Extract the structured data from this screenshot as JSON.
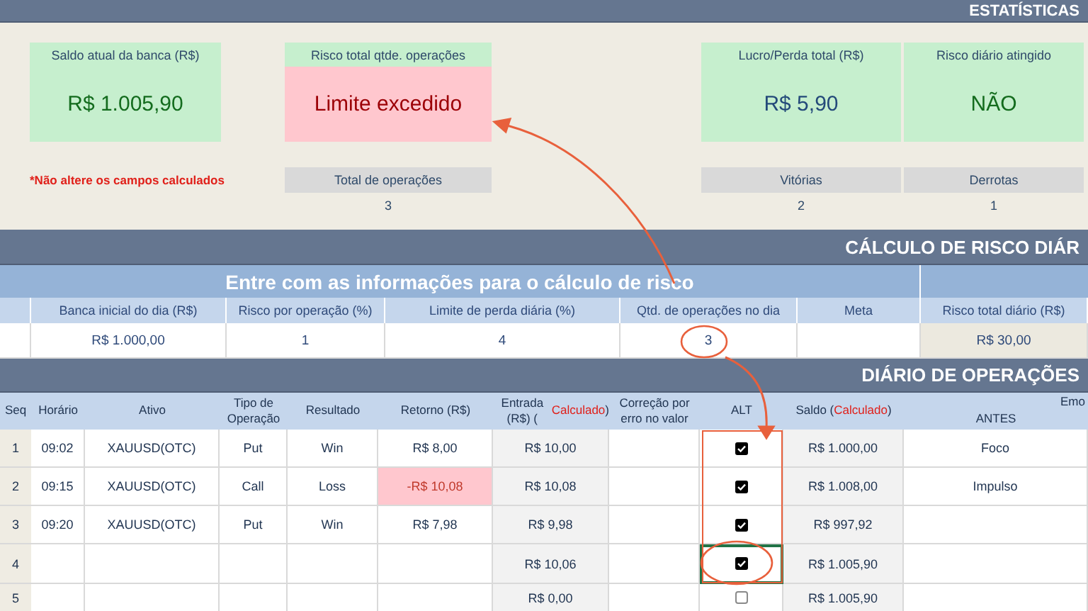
{
  "banner": {
    "title": "ESTATÍSTICAS"
  },
  "stats": {
    "cards": [
      {
        "label": "Saldo atual da banca (R$)",
        "value": "R$ 1.005,90",
        "alert": false,
        "color": "#146c1e"
      },
      {
        "label": "Risco total qtde. operações",
        "value": "Limite excedido",
        "alert": true,
        "color": "#9c0006"
      },
      {
        "label": "Lucro/Perda total (R$)",
        "value": "R$ 5,90",
        "alert": false,
        "color": "#244a7a"
      },
      {
        "label": "Risco diário atingido",
        "value": "NÃO",
        "alert": false,
        "color": "#146c1e"
      }
    ],
    "note": "*Não altere os campos calculados",
    "counters": [
      {
        "label": "Total de operações",
        "value": "3"
      },
      {
        "label": "Vitórias",
        "value": "2"
      },
      {
        "label": "Derrotas",
        "value": "1"
      }
    ]
  },
  "risk": {
    "title": "CÁLCULO DE RISCO DIÁR",
    "subtitle": "Entre com as informações para o cálculo de risco",
    "columns": [
      {
        "label": "Banca inicial do dia (R$)",
        "value": "R$ 1.000,00",
        "kind": "input"
      },
      {
        "label": "Risco por operação (%)",
        "value": "1",
        "kind": "input"
      },
      {
        "label": "Limite de perda diária (%)",
        "value": "4",
        "kind": "input"
      },
      {
        "label": "Qtd. de operações no dia",
        "value": "3",
        "kind": "input"
      },
      {
        "label": "Meta",
        "kind": "input"
      },
      {
        "label": "Risco total diário (R$)",
        "value": "R$ 30,00",
        "kind": "calculated"
      }
    ]
  },
  "journal": {
    "title": "DIÁRIO DE OPERAÇÕES",
    "group_header": "Emo",
    "columns": [
      [
        {
          "text": "Seq",
          "emphasis": false
        }
      ],
      [
        {
          "text": "Horário",
          "emphasis": false
        }
      ],
      [
        {
          "text": "Ativo",
          "emphasis": false
        }
      ],
      [
        {
          "text": "Tipo de Operação",
          "emphasis": false
        }
      ],
      [
        {
          "text": "Resultado",
          "emphasis": false
        }
      ],
      [
        {
          "text": "Retorno (R$)",
          "emphasis": false
        }
      ],
      [
        {
          "text": "Entrada (R$) (",
          "emphasis": false
        },
        {
          "text": "Calculado",
          "emphasis": true
        },
        {
          "text": ")",
          "emphasis": false
        }
      ],
      [
        {
          "text": "Correção por erro no valor",
          "emphasis": false
        }
      ],
      [
        {
          "text": "ALT",
          "emphasis": false
        }
      ],
      [
        {
          "text": "Saldo (",
          "emphasis": false
        },
        {
          "text": "Calculado",
          "emphasis": true
        },
        {
          "text": ")",
          "emphasis": false
        }
      ],
      [
        {
          "text": "ANTES",
          "emphasis": false
        }
      ]
    ],
    "rows": [
      {
        "seq": "1",
        "time": "09:02",
        "asset": "XAUUSD(OTC)",
        "type": "Put",
        "result": "Win",
        "return": "R$ 8,00",
        "loss": false,
        "entry": "R$ 10,00",
        "alt": true,
        "cursor": false,
        "balance": "R$ 1.000,00",
        "before": "Foco"
      },
      {
        "seq": "2",
        "time": "09:15",
        "asset": "XAUUSD(OTC)",
        "type": "Call",
        "result": "Loss",
        "return": "-R$ 10,08",
        "loss": true,
        "entry": "R$ 10,08",
        "alt": true,
        "cursor": false,
        "balance": "R$ 1.008,00",
        "before": "Impulso"
      },
      {
        "seq": "3",
        "time": "09:20",
        "asset": "XAUUSD(OTC)",
        "type": "Put",
        "result": "Win",
        "return": "R$ 7,98",
        "loss": false,
        "entry": "R$ 9,98",
        "alt": true,
        "cursor": false,
        "balance": "R$ 997,92"
      },
      {
        "seq": "4",
        "loss": false,
        "entry": "R$ 10,06",
        "alt": true,
        "cursor": true,
        "balance": "R$ 1.005,90"
      },
      {
        "seq": "5",
        "loss": false,
        "entry": "R$ 0,00",
        "alt": false,
        "cursor": false,
        "balance": "R$ 1.005,90"
      }
    ]
  }
}
